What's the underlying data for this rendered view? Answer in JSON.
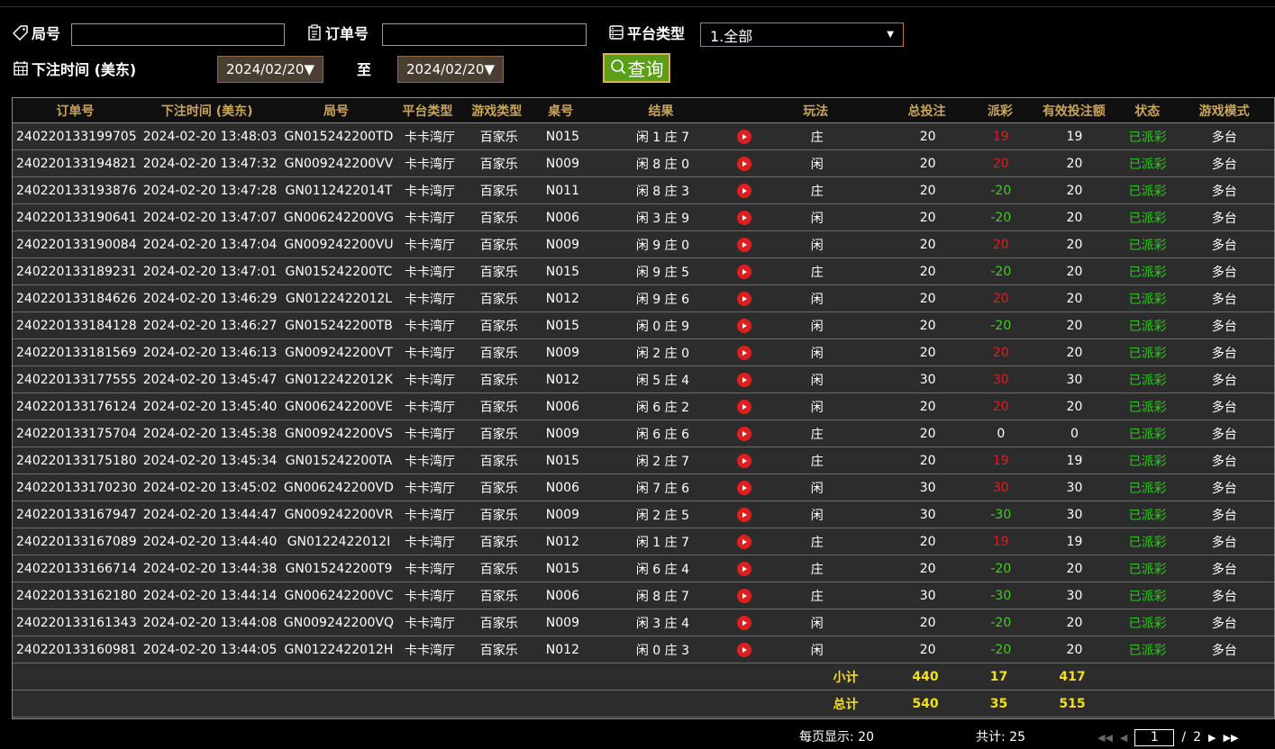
{
  "filters": {
    "game_no_label": "局号",
    "game_no_value": "",
    "order_no_label": "订单号",
    "order_no_value": "",
    "platform_label": "平台类型",
    "platform_selected": "1.全部",
    "bet_time_label": "下注时间 (美东)",
    "date_from": "2024/02/20",
    "to_label": "至",
    "date_to": "2024/02/20",
    "query_label": "查询"
  },
  "table": {
    "headers": [
      "订单号",
      "下注时间 (美东)",
      "局号",
      "平台类型",
      "游戏类型",
      "桌号",
      "结果",
      "玩法",
      "总投注",
      "派彩",
      "有效投注额",
      "状态",
      "游戏模式"
    ],
    "rows": [
      [
        "240220133199705",
        "2024-02-20 13:48:03",
        "GN015242200TD",
        "卡卡湾厅",
        "百家乐",
        "N015",
        "闲 1 庄 7",
        "庄",
        "20",
        "19",
        "19",
        "已派彩",
        "多台"
      ],
      [
        "240220133194821",
        "2024-02-20 13:47:32",
        "GN009242200VV",
        "卡卡湾厅",
        "百家乐",
        "N009",
        "闲 8 庄 0",
        "闲",
        "20",
        "20",
        "20",
        "已派彩",
        "多台"
      ],
      [
        "240220133193876",
        "2024-02-20 13:47:28",
        "GN0112422014T",
        "卡卡湾厅",
        "百家乐",
        "N011",
        "闲 8 庄 3",
        "庄",
        "20",
        "-20",
        "20",
        "已派彩",
        "多台"
      ],
      [
        "240220133190641",
        "2024-02-20 13:47:07",
        "GN006242200VG",
        "卡卡湾厅",
        "百家乐",
        "N006",
        "闲 3 庄 9",
        "闲",
        "20",
        "-20",
        "20",
        "已派彩",
        "多台"
      ],
      [
        "240220133190084",
        "2024-02-20 13:47:04",
        "GN009242200VU",
        "卡卡湾厅",
        "百家乐",
        "N009",
        "闲 9 庄 0",
        "闲",
        "20",
        "20",
        "20",
        "已派彩",
        "多台"
      ],
      [
        "240220133189231",
        "2024-02-20 13:47:01",
        "GN015242200TC",
        "卡卡湾厅",
        "百家乐",
        "N015",
        "闲 9 庄 5",
        "庄",
        "20",
        "-20",
        "20",
        "已派彩",
        "多台"
      ],
      [
        "240220133184626",
        "2024-02-20 13:46:29",
        "GN0122422012L",
        "卡卡湾厅",
        "百家乐",
        "N012",
        "闲 9 庄 6",
        "闲",
        "20",
        "20",
        "20",
        "已派彩",
        "多台"
      ],
      [
        "240220133184128",
        "2024-02-20 13:46:27",
        "GN015242200TB",
        "卡卡湾厅",
        "百家乐",
        "N015",
        "闲 0 庄 9",
        "闲",
        "20",
        "-20",
        "20",
        "已派彩",
        "多台"
      ],
      [
        "240220133181569",
        "2024-02-20 13:46:13",
        "GN009242200VT",
        "卡卡湾厅",
        "百家乐",
        "N009",
        "闲 2 庄 0",
        "闲",
        "20",
        "20",
        "20",
        "已派彩",
        "多台"
      ],
      [
        "240220133177555",
        "2024-02-20 13:45:47",
        "GN0122422012K",
        "卡卡湾厅",
        "百家乐",
        "N012",
        "闲 5 庄 4",
        "闲",
        "30",
        "30",
        "30",
        "已派彩",
        "多台"
      ],
      [
        "240220133176124",
        "2024-02-20 13:45:40",
        "GN006242200VE",
        "卡卡湾厅",
        "百家乐",
        "N006",
        "闲 6 庄 2",
        "闲",
        "20",
        "20",
        "20",
        "已派彩",
        "多台"
      ],
      [
        "240220133175704",
        "2024-02-20 13:45:38",
        "GN009242200VS",
        "卡卡湾厅",
        "百家乐",
        "N009",
        "闲 6 庄 6",
        "庄",
        "20",
        "0",
        "0",
        "已派彩",
        "多台"
      ],
      [
        "240220133175180",
        "2024-02-20 13:45:34",
        "GN015242200TA",
        "卡卡湾厅",
        "百家乐",
        "N015",
        "闲 2 庄 7",
        "庄",
        "20",
        "19",
        "19",
        "已派彩",
        "多台"
      ],
      [
        "240220133170230",
        "2024-02-20 13:45:02",
        "GN006242200VD",
        "卡卡湾厅",
        "百家乐",
        "N006",
        "闲 7 庄 6",
        "闲",
        "30",
        "30",
        "30",
        "已派彩",
        "多台"
      ],
      [
        "240220133167947",
        "2024-02-20 13:44:47",
        "GN009242200VR",
        "卡卡湾厅",
        "百家乐",
        "N009",
        "闲 2 庄 5",
        "闲",
        "30",
        "-30",
        "30",
        "已派彩",
        "多台"
      ],
      [
        "240220133167089",
        "2024-02-20 13:44:40",
        "GN0122422012I",
        "卡卡湾厅",
        "百家乐",
        "N012",
        "闲 1 庄 7",
        "庄",
        "20",
        "19",
        "19",
        "已派彩",
        "多台"
      ],
      [
        "240220133166714",
        "2024-02-20 13:44:38",
        "GN015242200T9",
        "卡卡湾厅",
        "百家乐",
        "N015",
        "闲 6 庄 4",
        "庄",
        "20",
        "-20",
        "20",
        "已派彩",
        "多台"
      ],
      [
        "240220133162180",
        "2024-02-20 13:44:14",
        "GN006242200VC",
        "卡卡湾厅",
        "百家乐",
        "N006",
        "闲 8 庄 7",
        "庄",
        "30",
        "-30",
        "30",
        "已派彩",
        "多台"
      ],
      [
        "240220133161343",
        "2024-02-20 13:44:08",
        "GN009242200VQ",
        "卡卡湾厅",
        "百家乐",
        "N009",
        "闲 3 庄 4",
        "闲",
        "20",
        "-20",
        "20",
        "已派彩",
        "多台"
      ],
      [
        "240220133160981",
        "2024-02-20 13:44:05",
        "GN0122422012H",
        "卡卡湾厅",
        "百家乐",
        "N012",
        "闲 0 庄 3",
        "闲",
        "20",
        "-20",
        "20",
        "已派彩",
        "多台"
      ]
    ],
    "subtotal": {
      "label": "小计",
      "bet": "440",
      "win": "17",
      "valid": "417"
    },
    "total": {
      "label": "总计",
      "bet": "540",
      "win": "35",
      "valid": "515"
    }
  },
  "pager": {
    "per_page_text": "每页显示: 20",
    "total_text": "共计: 25",
    "current_page": "1",
    "separator": "/",
    "total_pages": "2"
  },
  "colors": {
    "header_text": "#c9a45a",
    "win_positive": "#e01e1e",
    "win_negative": "#3ed01e",
    "status": "#2ec81e",
    "summary": "#f0e020"
  }
}
